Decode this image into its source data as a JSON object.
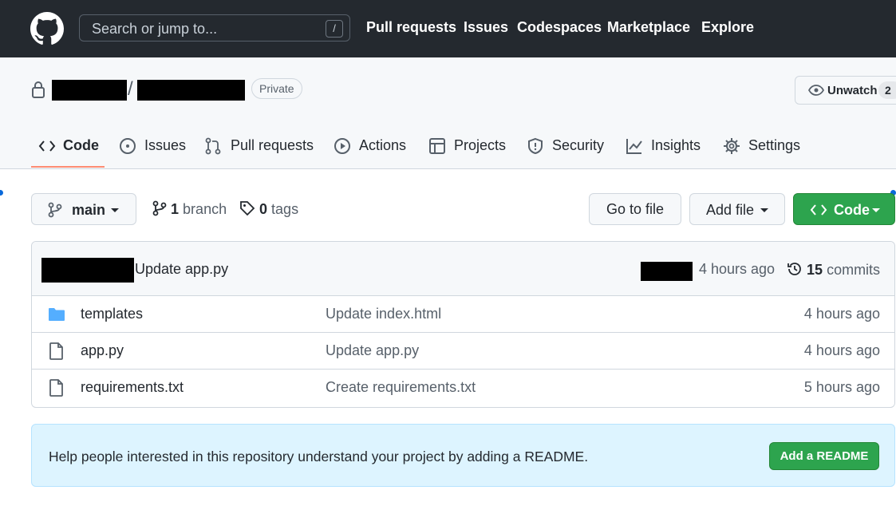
{
  "topnav": {
    "search_placeholder": "Search or jump to...",
    "search_shortcut": "/",
    "links": [
      "Pull requests",
      "Issues",
      "Codespaces",
      "Marketplace",
      "Explore"
    ]
  },
  "repo": {
    "separator": "/",
    "visibility": "Private",
    "unwatch_label": "Unwatch",
    "watch_count": "2"
  },
  "tabs": [
    {
      "label": "Code",
      "icon": "code-icon"
    },
    {
      "label": "Issues",
      "icon": "issue-circle-icon"
    },
    {
      "label": "Pull requests",
      "icon": "pull-request-icon"
    },
    {
      "label": "Actions",
      "icon": "play-icon"
    },
    {
      "label": "Projects",
      "icon": "table-icon"
    },
    {
      "label": "Security",
      "icon": "shield-icon"
    },
    {
      "label": "Insights",
      "icon": "graph-icon"
    },
    {
      "label": "Settings",
      "icon": "gear-icon"
    }
  ],
  "toolbar": {
    "branch_name": "main",
    "branch_count": "1",
    "branch_label": "branch",
    "tag_count": "0",
    "tag_label": "tags",
    "go_to_file": "Go to file",
    "add_file": "Add file",
    "code_button": "Code"
  },
  "latest_commit": {
    "message": "Update app.py",
    "time": "4 hours ago",
    "commit_count": "15",
    "commit_label": "commits"
  },
  "files": [
    {
      "type": "folder",
      "name": "templates",
      "message": "Update index.html",
      "age": "4 hours ago"
    },
    {
      "type": "file",
      "name": "app.py",
      "message": "Update app.py",
      "age": "4 hours ago"
    },
    {
      "type": "file",
      "name": "requirements.txt",
      "message": "Create requirements.txt",
      "age": "5 hours ago"
    }
  ],
  "readme": {
    "text": "Help people interested in this repository understand your project by adding a README.",
    "button": "Add a README"
  },
  "colors": {
    "header_bg": "#24292f",
    "accent_green": "#2da44e",
    "active_tab_underline": "#fd8c73",
    "folder_blue": "#54aeff",
    "readme_bg": "#ddf4ff"
  }
}
